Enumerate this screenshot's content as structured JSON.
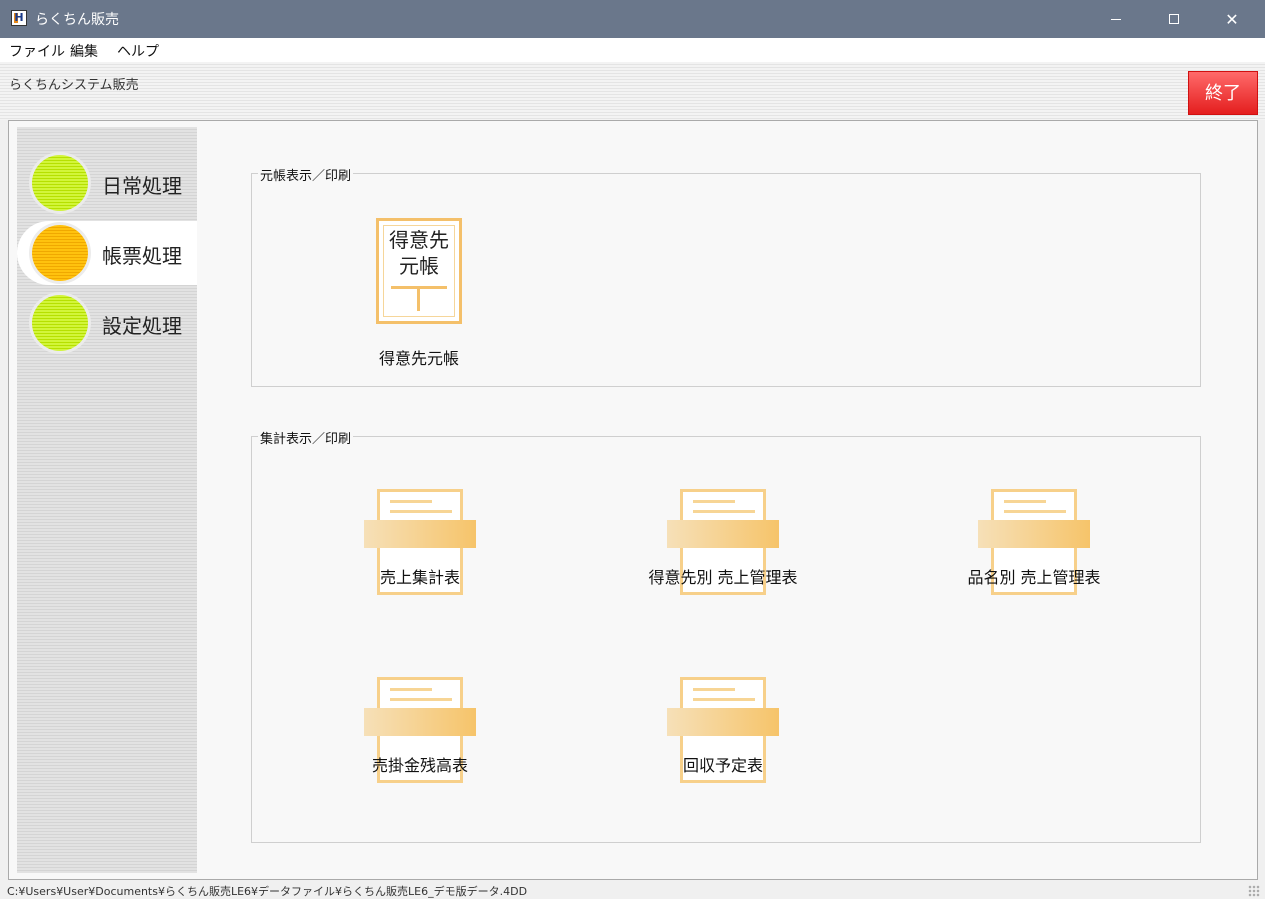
{
  "window": {
    "title": "らくちん販売",
    "icon_letter": "H"
  },
  "menu": [
    "ファイル",
    "編集",
    "ヘルプ"
  ],
  "header": {
    "system_name": "らくちんシステム販売",
    "quit_label": "終了",
    "quit_color": "#f03a3a"
  },
  "sidebar": {
    "items": [
      {
        "label": "日常処理",
        "color": "#c8ee10",
        "active": false
      },
      {
        "label": "帳票処理",
        "color": "#ffb800",
        "active": true
      },
      {
        "label": "設定処理",
        "color": "#c8ee10",
        "active": false
      }
    ]
  },
  "ledger_group": {
    "title": "元帳表示／印刷",
    "icon_text_line1": "得意先",
    "icon_text_line2": "元帳",
    "button_label": "得意先元帳"
  },
  "summary_group": {
    "title": "集計表示／印刷",
    "buttons": [
      {
        "label": "売上集計表"
      },
      {
        "label": "得意先別 売上管理表"
      },
      {
        "label": "品名別 売上管理表"
      },
      {
        "label": "売掛金残高表"
      },
      {
        "label": "回収予定表"
      }
    ]
  },
  "statusbar": {
    "path": "C:¥Users¥User¥Documents¥らくちん販売LE6¥データファイル¥らくちん販売LE6_デモ版データ.4DD"
  }
}
